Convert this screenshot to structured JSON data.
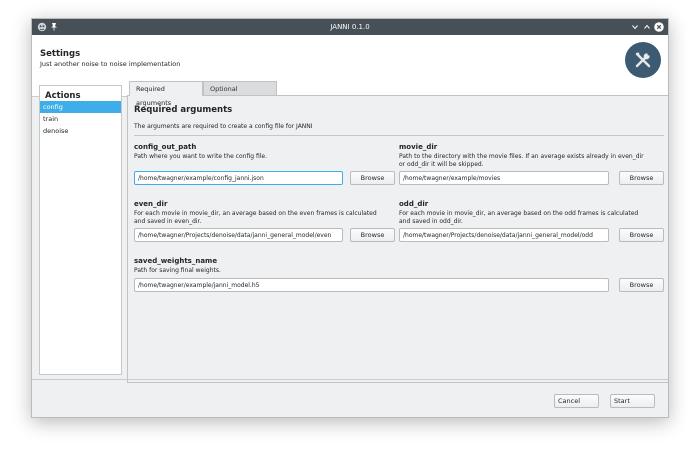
{
  "window": {
    "title": "JANNI 0.1.0"
  },
  "header": {
    "title": "Settings",
    "subtitle": "Just another noise to noise implementation",
    "icon": "tools-icon"
  },
  "actions": {
    "title": "Actions",
    "items": [
      {
        "label": "config",
        "selected": true
      },
      {
        "label": "train",
        "selected": false
      },
      {
        "label": "denoise",
        "selected": false
      }
    ]
  },
  "tabs": [
    {
      "label": "Required arguments",
      "active": true
    },
    {
      "label": "Optional arguments",
      "active": false
    }
  ],
  "panel": {
    "title": "Required arguments",
    "description": "The arguments are required to create a config file for JANNI"
  },
  "fields": {
    "config_out_path": {
      "label": "config_out_path",
      "desc1": "Path where you want to write the config file.",
      "desc2": "",
      "value": "/home/twagner/example/config_janni.json",
      "button": "Browse"
    },
    "movie_dir": {
      "label": "movie_dir",
      "desc1": "Path to the directory with the movie files. If an average exists already in even_dir",
      "desc2": "or odd_dir it will be skipped.",
      "value": "/home/twagner/example/movies",
      "button": "Browse"
    },
    "even_dir": {
      "label": "even_dir",
      "desc1": "For each movie in movie_dir, an average based on the even frames is calculated",
      "desc2": "and saved in even_dir.",
      "value": "/home/twagner/Projects/denoise/data/janni_general_model/even",
      "button": "Browse"
    },
    "odd_dir": {
      "label": "odd_dir",
      "desc1": "For each movie in movie_dir, an average based on the odd frames is calculated",
      "desc2": "and saved in odd_dir.",
      "value": "/home/twagner/Projects/denoise/data/janni_general_model/odd",
      "button": "Browse"
    },
    "saved_weights_name": {
      "label": "saved_weights_name",
      "desc1": "Path for saving final weights.",
      "desc2": "",
      "value": "/home/twagner/example/janni_model.h5",
      "button": "Browse"
    }
  },
  "footer": {
    "cancel": "Cancel",
    "start": "Start"
  },
  "colors": {
    "accent": "#3daee9",
    "titlebar": "#475057",
    "icon_bg": "#3d5a73"
  }
}
